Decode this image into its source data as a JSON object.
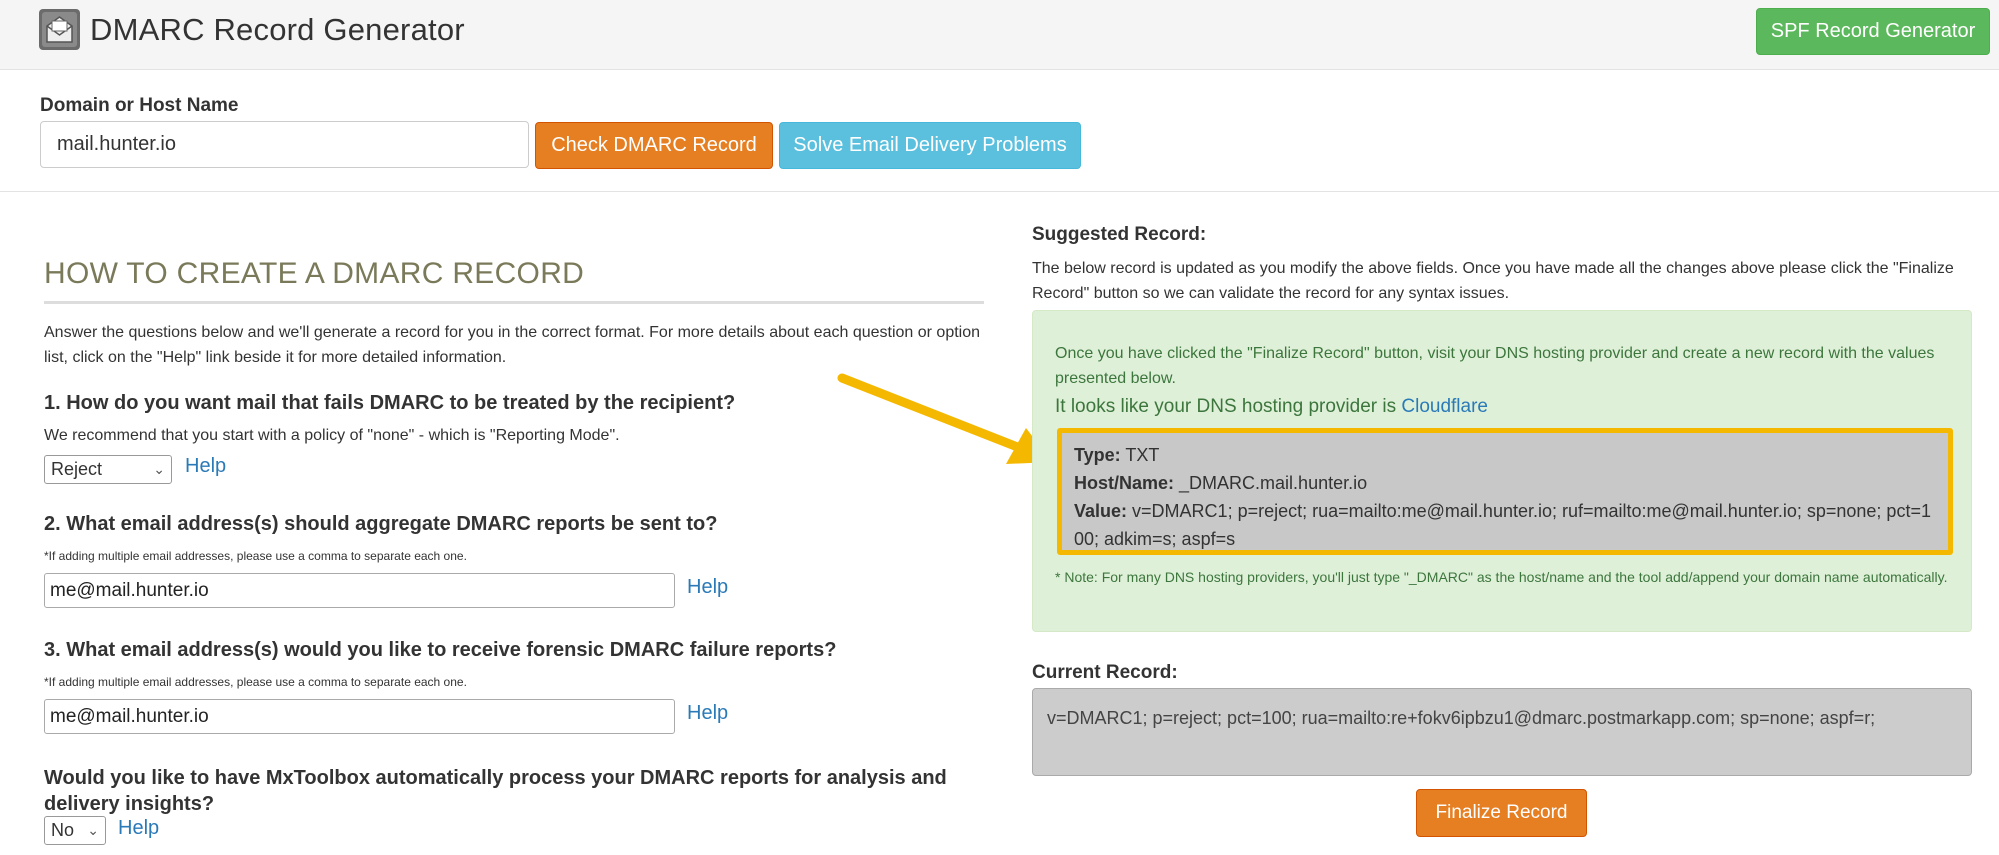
{
  "header": {
    "title": "DMARC Record Generator",
    "spf_button": "SPF Record Generator"
  },
  "search": {
    "label": "Domain or Host Name",
    "value": "mail.hunter.io",
    "check_button": "Check DMARC Record",
    "solve_button": "Solve Email Delivery Problems"
  },
  "how": {
    "title": "HOW TO CREATE A DMARC RECORD",
    "intro": "Answer the questions below and we'll generate a record for you in the correct format. For more details about each question or option list, click on the \"Help\" link beside it for more detailed information."
  },
  "questions": {
    "q1": {
      "label": "1. How do you want mail that fails DMARC to be treated by the recipient?",
      "note": "We recommend that you start with a policy of \"none\" - which is \"Reporting Mode\".",
      "select_value": "Reject",
      "help": "Help"
    },
    "q2": {
      "label": "2. What email address(s) should aggregate DMARC reports be sent to?",
      "note": "*If adding multiple email addresses, please use a comma to separate each one.",
      "value": "me@mail.hunter.io",
      "help": "Help"
    },
    "q3": {
      "label": "3. What email address(s) would you like to receive forensic DMARC failure reports?",
      "note": "*If adding multiple email addresses, please use a comma to separate each one.",
      "value": "me@mail.hunter.io",
      "help": "Help"
    },
    "q4": {
      "label": "Would you like to have MxToolbox automatically process your DMARC reports for analysis and delivery insights?",
      "select_value": "No",
      "help": "Help"
    }
  },
  "suggested": {
    "title": "Suggested Record:",
    "description": "The below record is updated as you modify the above fields. Once you have made all the changes above please click the \"Finalize Record\" button so we can validate the record for any syntax issues.",
    "instructions": "Once you have clicked the \"Finalize Record\" button, visit your DNS hosting provider and create a new record with the values presented below.",
    "provider_prefix": "It looks like your DNS hosting provider is ",
    "provider_name": "Cloudflare",
    "type_label": "Type:",
    "type_value": "TXT",
    "host_label": "Host/Name:",
    "host_value": "_DMARC.mail.hunter.io",
    "value_label": "Value:",
    "value_value": "v=DMARC1; p=reject; rua=mailto:me@mail.hunter.io; ruf=mailto:me@mail.hunter.io; sp=none; pct=100; adkim=s; aspf=s",
    "note": "* Note: For many DNS hosting providers, you'll just type \"_DMARC\" as the host/name and the tool add/append your domain name automatically."
  },
  "current": {
    "title": "Current Record:",
    "value": "v=DMARC1; p=reject; pct=100; rua=mailto:re+fokv6ipbzu1@dmarc.postmarkapp.com; sp=none; aspf=r;",
    "finalize_button": "Finalize Record"
  },
  "colors": {
    "spf_green": "#5cb85c",
    "orange": "#e67e22",
    "info_blue": "#5bc0de",
    "success_bg": "#dff0d8",
    "highlight_yellow": "#f5b800",
    "link_blue": "#2a7ab8"
  },
  "icons": {
    "logo": "envelope-icon",
    "select_chevron": "chevron-down-icon",
    "annotation_arrow": "arrow-icon"
  }
}
